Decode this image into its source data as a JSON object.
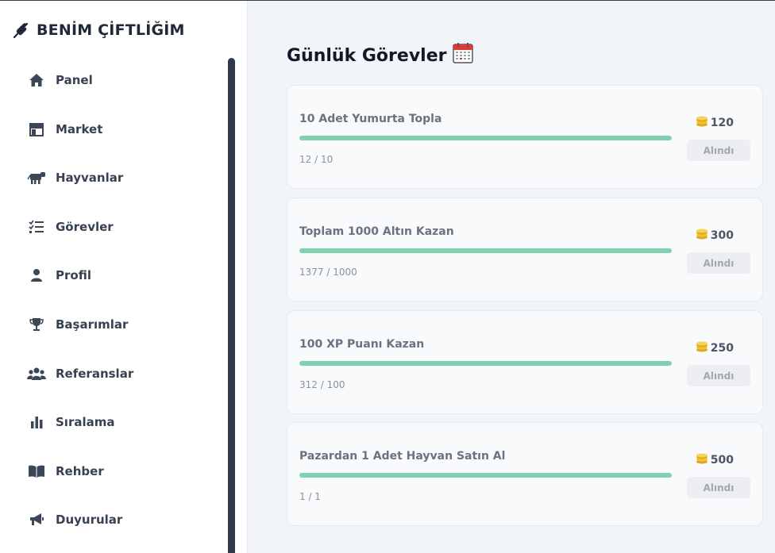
{
  "app": {
    "title": "BENİM ÇİFTLİĞİM",
    "logo_icon": "wheat-icon"
  },
  "sidebar": {
    "items": [
      {
        "label": "Panel",
        "icon": "home-icon"
      },
      {
        "label": "Market",
        "icon": "store-icon"
      },
      {
        "label": "Hayvanlar",
        "icon": "cow-icon"
      },
      {
        "label": "Görevler",
        "icon": "tasks-icon"
      },
      {
        "label": "Profil",
        "icon": "user-icon"
      },
      {
        "label": "Başarımlar",
        "icon": "trophy-icon"
      },
      {
        "label": "Referanslar",
        "icon": "users-icon"
      },
      {
        "label": "Sıralama",
        "icon": "bar-chart-icon"
      },
      {
        "label": "Rehber",
        "icon": "book-icon"
      },
      {
        "label": "Duyurular",
        "icon": "megaphone-icon"
      }
    ]
  },
  "main": {
    "title": "Günlük Görevler",
    "title_icon": "calendar-icon",
    "tasks": [
      {
        "title": "10 Adet Yumurta Topla",
        "progress_text": "12 / 10",
        "progress": 1.0,
        "reward": "120",
        "button": "Alındı"
      },
      {
        "title": "Toplam 1000 Altın Kazan",
        "progress_text": "1377 / 1000",
        "progress": 1.0,
        "reward": "300",
        "button": "Alındı"
      },
      {
        "title": "100 XP Puanı Kazan",
        "progress_text": "312 / 100",
        "progress": 1.0,
        "reward": "250",
        "button": "Alındı"
      },
      {
        "title": "Pazardan 1 Adet Hayvan Satın Al",
        "progress_text": "1 / 1",
        "progress": 1.0,
        "reward": "500",
        "button": "Alındı"
      }
    ]
  },
  "colors": {
    "progress": "#7fd1b0",
    "coin": "#f2c230",
    "sidebar_scroll": "#2f3b4a"
  }
}
